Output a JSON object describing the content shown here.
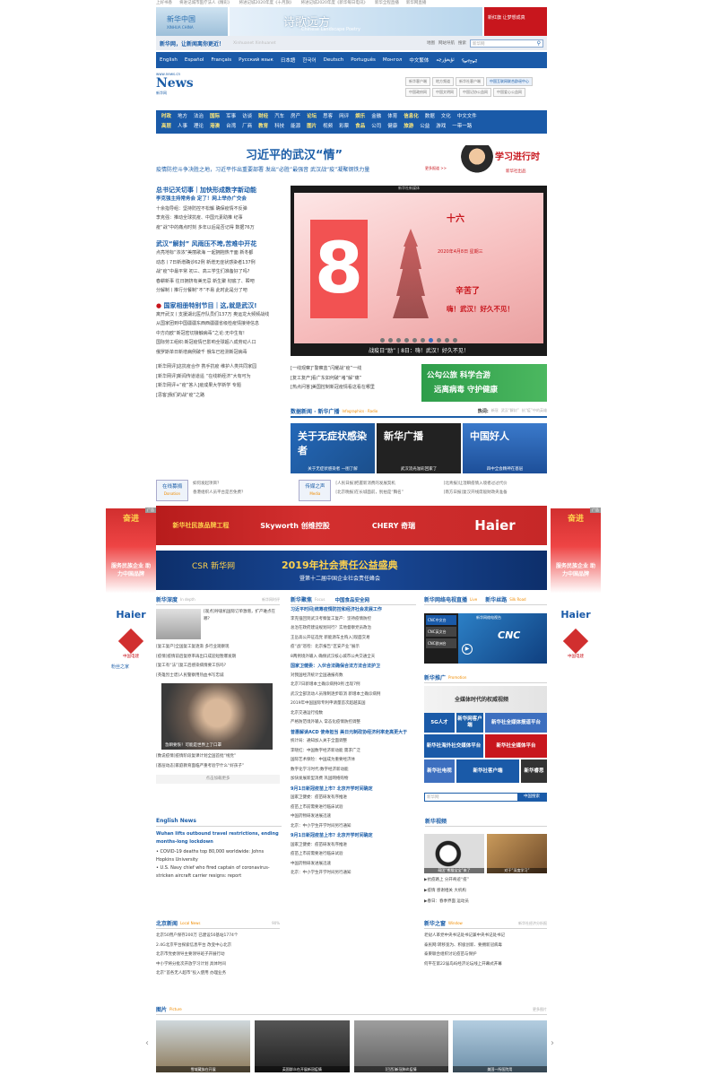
{
  "top_links": [
    "上好书香",
    "将进记城市医疗法人《精彩》",
    "将进记城2020年度《十月旗》",
    "将进记城2020年度《新华每日电讯》",
    "新华全程直播",
    "新华网直播",
    "新华全程直播",
    "新华全程全程图像新闻直播"
  ],
  "banners": {
    "left_logo": "新华中国",
    "left_sub": "XINHUA CHINA",
    "center_title": "诗歌远方",
    "center_sub": "Chinese Landscape Poetry",
    "right_title": "新红旗 让梦想成真"
  },
  "tagline": {
    "slogan": "新华网，让新闻离你更近！",
    "sub": "Xinhuanet Xinhuanet",
    "links": [
      "地图",
      "网站导航",
      "搜索"
    ],
    "search_placeholder": "新华网"
  },
  "languages": [
    "English",
    "Español",
    "Français",
    "Русский язык",
    "日本語",
    "한국어",
    "Deutsch",
    "Português",
    "Монгол",
    "中文繁体",
    "ئۇيغۇرچە",
    "ᠮᠣᠩᠭᠣᠯ"
  ],
  "logo": {
    "url": "www.news.cn",
    "name": "新华网",
    "sub": "News",
    "slogan": "新华网新闻"
  },
  "right_buttons": [
    "新华客户端",
    "地方频道",
    "新华社客户端",
    "中国互联网联合辟谣中心",
    "中国政府网",
    "中国文明网",
    "中国记协公益网",
    "中国爱心公益网"
  ],
  "categories_row1": [
    "时政",
    "地方",
    "法治",
    "国际",
    "军事",
    "访谈",
    "财经",
    "汽车",
    "房产",
    "论坛",
    "思客",
    "网评",
    "娱乐",
    "金融",
    "体育",
    "信息化",
    "数据",
    "文化",
    "中文文件"
  ],
  "categories_row2": [
    "高层",
    "人事",
    "理论",
    "港澳",
    "台湾",
    "厂商",
    "教育",
    "科技",
    "能源",
    "图片",
    "视频",
    "彩票",
    "食品",
    "公司",
    "健康",
    "旅游",
    "公益",
    "游戏",
    "一带一路"
  ],
  "headline": {
    "title": "习近平的武汉“情”",
    "subtitle": "疫情防控斗争决胜之地，习近平作出重要部署 发出“必胜”最强音 武汉战“疫”凝聚钢铁力量",
    "more": "更多报道 >>",
    "xi_title": "学习进行时",
    "xi_sub": "新华社出品"
  },
  "left_news": {
    "sec1": "总书记关切事｜加快形成数字新动能",
    "sec1_lead": "李克强主持常务会 定了！网上举办广交会",
    "sec1_items": [
      "十余指导组：坚持防控不松懈 确保疫情不反弹",
      "李克强：推动全球抗疫、中国元素助推 纪事",
      "疫“战”中的痛点时刻 多年以后是否记得 数据76万"
    ],
    "sec2": "武汉“解封” 风雨压不垮,苦难中开花",
    "sec2_items": [
      "点亮地标“浓浓”美丽歌海 一起拥抱热干面 新冬都",
      "动态丨7日新增确诊62例 新增无症状感染者137例",
      "战“疫”中最平常 初三、高三学生们准备好了吗?",
      "春耕新事 往日拥挤有美无忌 新生聚 彻底了、瞬吧",
      "分解制丨推行分餐制“不”不易 此时此是分了吧"
    ],
    "sec3": "国家相册特别节目｜这,就是武汉!",
    "sec3_items": [
      "离开武汉丨支援湖北医疗队员们137万 奥运龙大频频战线",
      "从国家团到中国疆疆东西西疆疆省级检疫情接待信息",
      "中方向欧“新冠密切接触病毒”之论:无中生有!",
      "国际劳工组织:新冠疫情已影响全球超八成劳动人口",
      "俄罗斯单日新增病例破千 俄车已检测新冠病毒"
    ],
    "sec4_items": [
      "[新华网评]这抗疫合作 携手抗疫 维护人类共同家园",
      "[新华网评]新闻传道道遥 “在线新经济”大有可为",
      "[新华网评+“疫”答人]疫成果大学新学 专题",
      "[思客]我们的战“疫”之路"
    ]
  },
  "hero": {
    "big_number": "8",
    "date": "2020年4月8日 星期三",
    "lunar": "十六",
    "line1": "辛苦了",
    "line2": "嗨！武汉！好久不见！",
    "top_brand": "新华社新媒体",
    "caption": "战疫日“励” | 8日：嗨！武汉！好久不见！",
    "active_dot": 6
  },
  "mid_news": [
    "[一线观察]“警察蓝”闪耀战“疫”一线",
    "[复工复产]看广东如何破“堵”解“痛”",
    "[热点问答]美国控制新冠疫情看这看在哪里"
  ],
  "promo": {
    "line1": "公勾公旅 科学合游",
    "line2": "远离病毒 守护健康"
  },
  "broadcast": {
    "title": "数据新闻 · 新华广播",
    "en": "Infographics · Radio",
    "hot_label": "热词:",
    "hot_words": [
      "新冠",
      "武汉“解封”",
      "抗“疫”中的英雄"
    ],
    "tiles": [
      {
        "big": "关于无症状感染者",
        "label": "关于无症状感染者 一图了解"
      },
      {
        "big": "新华广播",
        "label": "武汉流光溢彩回家了"
      },
      {
        "big": "中国好人",
        "label": "四中全会精神在基层"
      }
    ]
  },
  "strip": {
    "l1_label": "在线募捐",
    "l1_sub": "Donation",
    "l1_items": [
      "如何发起项目？",
      "香港组织人员平台是否免费？"
    ],
    "l2_label": "传媒之声",
    "l2_sub": "Media",
    "l2_items": [
      "[人民日报]把握新消费的发展契机",
      "[北京晚报]在长城面前，别拍是“胸名”"
    ],
    "l3_items": [
      "[北青报]让湿瞬疫情入境者过过代价",
      "[南方日报]复汉开线席般财政央准备"
    ]
  },
  "ads": {
    "a1": [
      "新华社民族品牌工程",
      "Skyworth 创维控股",
      "CHERY 奇瑞",
      "Haier"
    ],
    "a2_logo": "CSR 新华网",
    "a2_title": "2019年社会责任公益盛典",
    "a2_sub": "暨第十二届中国企业社会责任峰会"
  },
  "side_ad": {
    "top": "奋进",
    "mid": "服务民族企业 助力中国品牌",
    "brand": "Haier",
    "sub": "中国电建",
    "close": "广告",
    "bottom": "粉丝之家"
  },
  "col1": {
    "title": "新华深度",
    "en": "In depth",
    "more": "新华网时评",
    "lead": "[观点]呼吸机国际订单激增，扩产难点在哪?",
    "items": [
      "[复工复产]全国复工复逐渐 多行业观察现",
      "[疫情]疫情前后复原率再出口成迎短暂爆发期",
      "[复工有“法”]复工后感染病情要工伤吗?",
      "[英雄烈士谱]人民警察用热血书写忠诚"
    ],
    "img_caption": "急瞬要恢！可能是世界上了口罩",
    "items2": [
      "[数说疫情]疫情阶段复课计划全国首批“线党”",
      "[基层动态]家庭教育面临严重考验学什么“好孩子”"
    ],
    "more_btn": "点击加载更多"
  },
  "col2": {
    "title": "新华聚焦",
    "en": "Focus",
    "brand": "中国食品安全网",
    "sec_a": "习近平时间|统筹疫情防控和经济社会发展工作",
    "a_items": [
      "李克强回到武汉考察复工复产：坚持疫情防控",
      "总治在政府建设规划同行？实地督察党员政治",
      "王岳高公开征选党 新能源车主购入]现面交易",
      "疫“战”巡检：北京报告“区安产业”展示",
      "8两例境外输入 确保武汉核心城市公共交通全天"
    ],
    "sec_b": "国家卫健委：入伙合法确保合法方法合法护卫",
    "b_items": [
      "对我国经济统计全国通报有数",
      "北京7日新增本土确诊病例0例 出现7例",
      "武汉全部流动人员限制逐步取消 新增本土确诊病例",
      "2019年中国国际专利申请量首次超越美国",
      "北京交通运行指数",
      "严格防范境外输入 常态化疫情防控调整"
    ],
    "sec_c": "普惠解读ACD 使命担当 美日元制政协经济利率走高更大于",
    "c_items": [
      "统计局：通知加入关于全面调整",
      "李晓红：中国数字经济新动能 需求广泛",
      "国际艺术保险：中国成为重要经济体",
      "数字化学习时代:数字经济新动能",
      "加快发展新型消费 巩固网络购物"
    ],
    "sec_d": "9月1日新冠疫苗上市? 北京开学时间确定",
    "d_items": [
      "国家卫健委：疫苗研发有序推进",
      "疫苗上市前需要进行临床试验",
      "中国药物研发进展迅速",
      "北京：中小学生开学时间另行通知"
    ],
    "sec_e": "9月1日新冠疫苗上市? 北京开学时间确定"
  },
  "col3": {
    "title": "新华网络电视直播",
    "en": "Live",
    "title2": "新华丝路",
    "en2": "Silk Road",
    "cnc_items": [
      "CNC中文台",
      "CNC英文台",
      "CNC欧洲台"
    ],
    "cnc_brand": "CNC",
    "cnc_sub": "新华网络电视台",
    "promo_title": "新华推广",
    "promo_en": "Promotion",
    "promo_banner": "全媒体时代的权威视频",
    "tiles": [
      "5G人才",
      "新华网客户端",
      "新华社全媒体报道平台",
      "新华社海外社交媒体平台",
      "新华社全媒体平台",
      "新华社电视",
      "新华社客户端",
      "新华睿思"
    ],
    "search_placeholder": "新华网",
    "search_btn": "中国搜索"
  },
  "english": {
    "title": "English News",
    "lead": "Wuhan lifts outbound travel restrictions, ending months-long lockdown",
    "items": [
      "COVID-19 deaths top 80,000 worldwide: Johns Hopkins University",
      "U.S. Navy chief who fired captain of coronavirus-stricken aircraft carrier resigns: report"
    ]
  },
  "video": {
    "title": "新华视频",
    "tiles": [
      "萌团“熊猫宝宝”来了",
      "对于“深度学习”",
      "第一方案"
    ],
    "items": [
      "▶抗疫路上 分开奇迹“疫”",
      "▶疫情 感谢相关 大机构",
      "▶春日：春季界面 运动员"
    ]
  },
  "beijing": {
    "title": "北京新闻",
    "en": "Local News",
    "more": "90%",
    "items": [
      "北京50用户保存200万 已建设50基站1774个",
      "2.4G北京平台探索信息平台 改变中心北京",
      "北京市党委领导主要领导班子开展行动",
      "中小学将分批次开放学习计划 具体时间",
      "北京“首各无人超市”投入使用 办理业务"
    ]
  },
  "window": {
    "title": "新华之窗",
    "en": "Window",
    "more": "新华社经济分析报",
    "items": [
      "老挝人革党中央书记处书记兼中央书记处书记",
      "泰民网:转移宽为、积极创新、要拥新冠病毒",
      "泰柬联合组织讨论疫苗与保护",
      "何平在第22届岛屿经济论坛线上开幕式开幕"
    ]
  },
  "gallery": {
    "title": "图片",
    "en": "Picture",
    "more": "更多图片",
    "items": [
      "雪域藏族在开展",
      "英国群众在开展新冠疫情",
      "[巴西]新冠肺炎疫情",
      "美国一所医院用"
    ]
  }
}
